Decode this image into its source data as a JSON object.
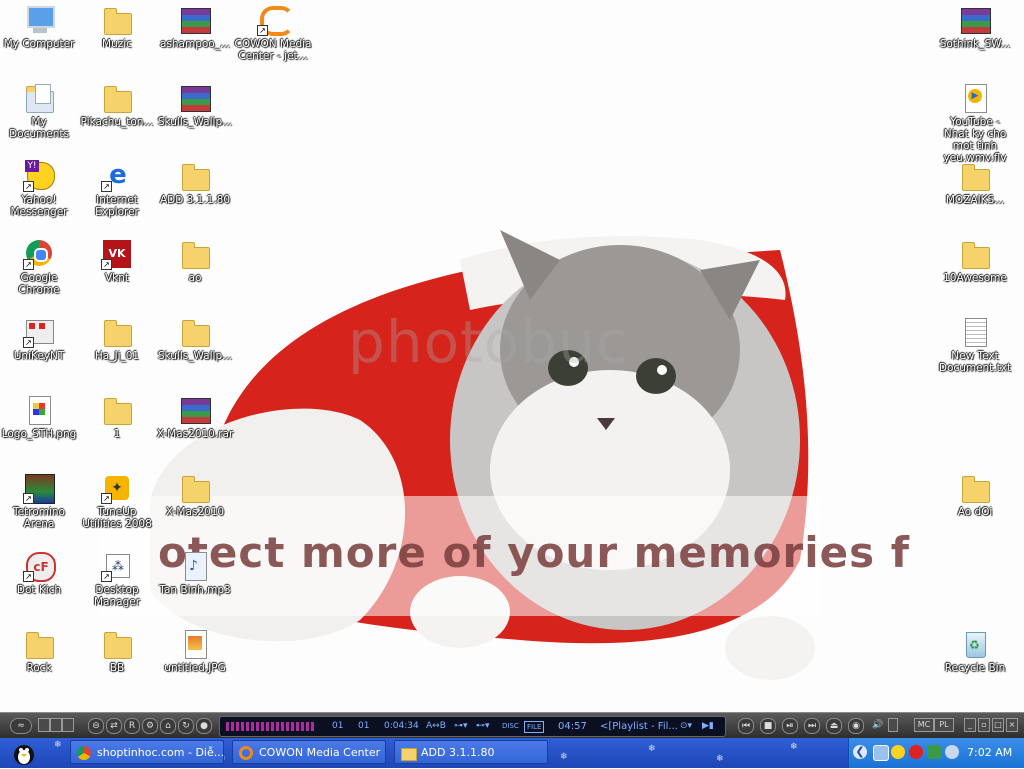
{
  "desktop": {
    "wallpaper": {
      "watermark": "photobuc",
      "banner": "otect more of your memories f"
    },
    "icons": [
      {
        "label": "My Computer",
        "icon": "computer-icon"
      },
      {
        "label": "My Documents",
        "icon": "documents-icon"
      },
      {
        "label": "Yahoo! Messenger",
        "icon": "yahoo-messenger-icon"
      },
      {
        "label": "Google Chrome",
        "icon": "chrome-icon"
      },
      {
        "label": "UniKeyNT",
        "icon": "unikey-icon"
      },
      {
        "label": "Logo_STH.png",
        "icon": "image-file-icon"
      },
      {
        "label": "Tetromino Arena",
        "icon": "game-icon"
      },
      {
        "label": "Dot Kich",
        "icon": "dot-kich-icon"
      },
      {
        "label": "Rock",
        "icon": "folder-icon"
      },
      {
        "label": "Muzic",
        "icon": "folder-icon"
      },
      {
        "label": "Pikachu_ton...",
        "icon": "folder-icon"
      },
      {
        "label": "Internet Explorer",
        "icon": "ie-icon"
      },
      {
        "label": "Vknt",
        "icon": "vknt-icon"
      },
      {
        "label": "Ha_Ji_01",
        "icon": "folder-icon"
      },
      {
        "label": "1",
        "icon": "folder-icon"
      },
      {
        "label": "TuneUp Utilities 2008",
        "icon": "tuneup-icon"
      },
      {
        "label": "Desktop Manager",
        "icon": "desktop-manager-icon"
      },
      {
        "label": "BB",
        "icon": "folder-icon"
      },
      {
        "label": "ashampoo_...",
        "icon": "rar-archive-icon"
      },
      {
        "label": "Skulls_Wallp...",
        "icon": "rar-archive-icon"
      },
      {
        "label": "ADD 3.1.1.80",
        "icon": "folder-icon"
      },
      {
        "label": "ao",
        "icon": "folder-icon"
      },
      {
        "label": "Skulls_Wallp...",
        "icon": "folder-icon"
      },
      {
        "label": "X-Mas2010.rar",
        "icon": "rar-archive-icon"
      },
      {
        "label": "X-Mas2010",
        "icon": "folder-icon"
      },
      {
        "label": "Tan Binh.mp3",
        "icon": "mp3-file-icon"
      },
      {
        "label": "untitled.JPG",
        "icon": "jpg-file-icon"
      },
      {
        "label": "COWON Media Center - jet...",
        "icon": "cowon-icon"
      },
      {
        "label": "Sothink_SW...",
        "icon": "rar-archive-icon"
      },
      {
        "label": "YouTube - Nhat ky cho mot tinh yeu.wmv.flv",
        "icon": "media-file-icon"
      },
      {
        "label": "MOZAIKS...",
        "icon": "folder-icon"
      },
      {
        "label": "10Awesome",
        "icon": "folder-icon"
      },
      {
        "label": "New Text Document.txt",
        "icon": "text-file-icon"
      },
      {
        "label": "Ao dOi",
        "icon": "folder-icon"
      },
      {
        "label": "Recycle Bin",
        "icon": "recycle-bin-icon"
      }
    ]
  },
  "player": {
    "track_no": "01",
    "disc_no": "01",
    "elapsed": "0:04:34",
    "ab_label": "A↔B",
    "disc_label": "DISC",
    "file_label": "FILE",
    "total": "04:57",
    "playlist": "<[Playlist - Fil...",
    "mc_label": "MC",
    "pl_label": "PL"
  },
  "taskbar": {
    "tasks": [
      {
        "label": "shoptinhoc.com - Diễ...",
        "icon": "chrome-icon"
      },
      {
        "label": "COWON Media Center",
        "icon": "cowon-icon"
      },
      {
        "label": "ADD 3.1.1.80",
        "icon": "folder-icon"
      }
    ],
    "clock": "7:02 AM"
  },
  "colors": {
    "taskbar": "#245edb",
    "tray": "#1a73d6",
    "player": "#3a3a3a",
    "lcd": "#0a0f22",
    "lcd_text": "#7fb0ff",
    "hat_red": "#d6241c"
  }
}
